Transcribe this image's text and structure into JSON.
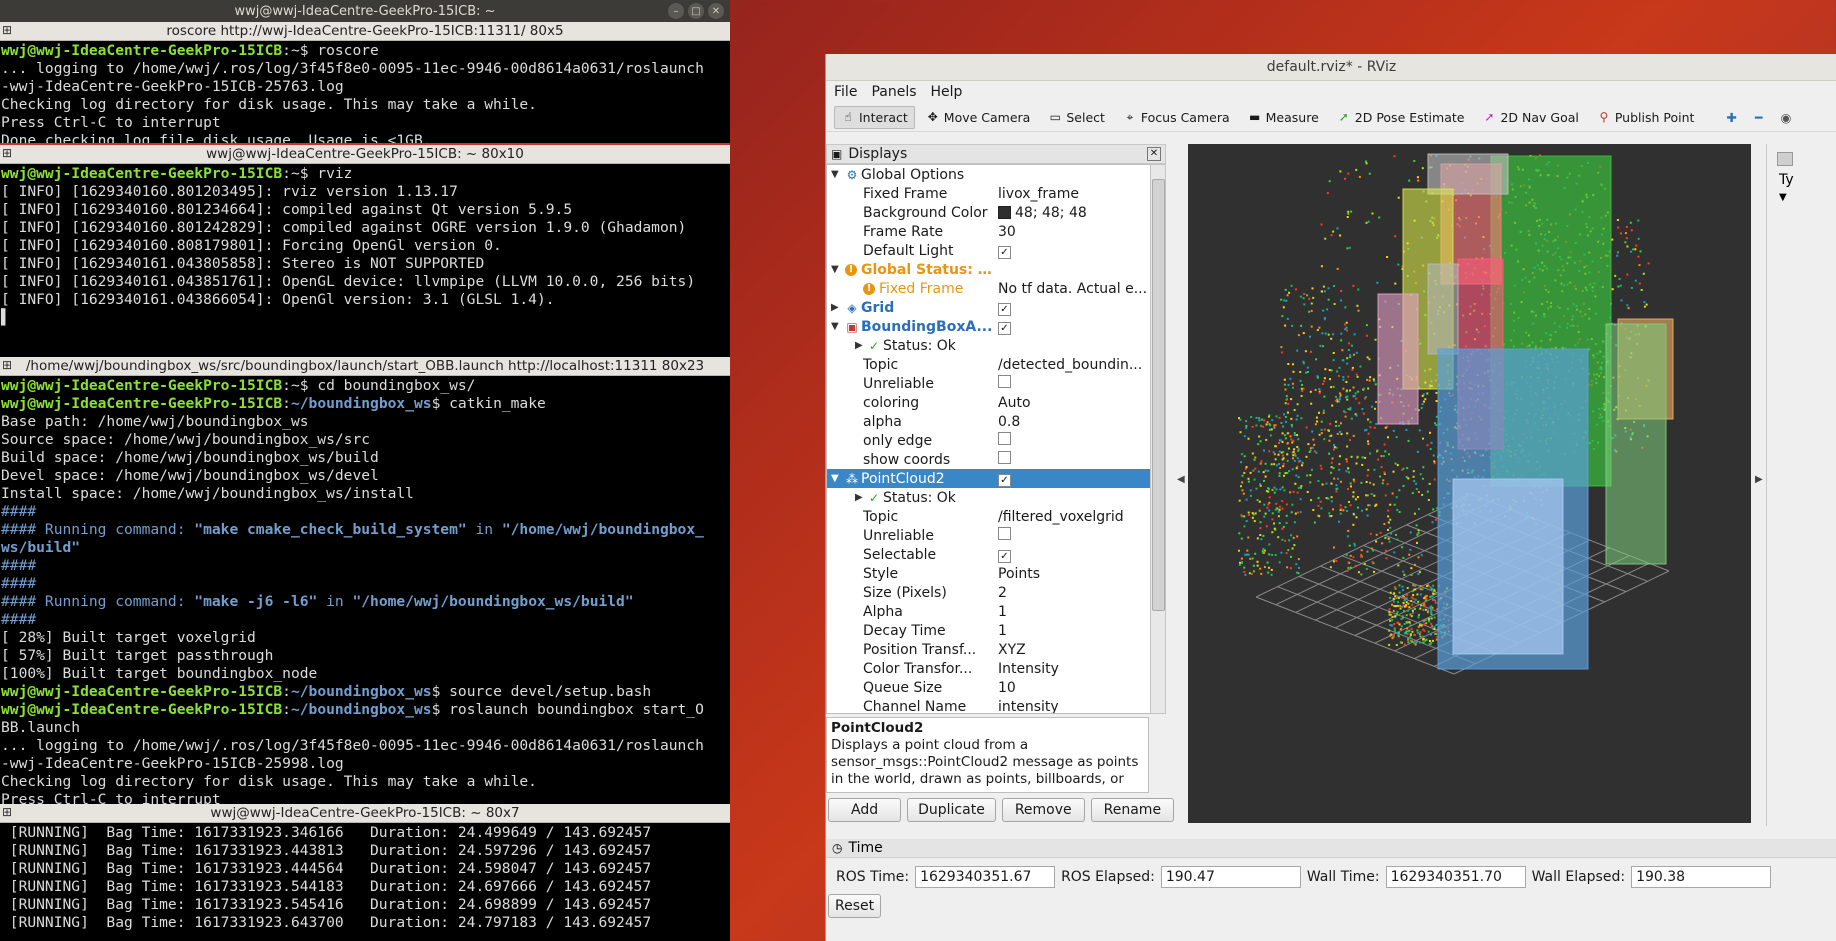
{
  "terminal": {
    "window_title": "wwj@wwj-IdeaCentre-GeekPro-15ICB: ~",
    "panes": [
      {
        "title": "roscore http://wwj-IdeaCentre-GeekPro-15ICB:11311/ 80x5",
        "lines": [
          [
            {
              "t": "wwj@wwj-IdeaCentre-GeekPro-15ICB",
              "c": "g"
            },
            {
              "t": ":~$ roscore"
            }
          ],
          [
            {
              "t": "... logging to /home/wwj/.ros/log/3f45f8e0-0095-11ec-9946-00d8614a0631/roslaunch"
            }
          ],
          [
            {
              "t": "-wwj-IdeaCentre-GeekPro-15ICB-25763.log"
            }
          ],
          [
            {
              "t": "Checking log directory for disk usage. This may take a while."
            }
          ],
          [
            {
              "t": "Press Ctrl-C to interrupt"
            }
          ],
          [
            {
              "t": "Done checking log file disk usage. Usage is <1GB."
            }
          ]
        ]
      },
      {
        "title": "wwj@wwj-IdeaCentre-GeekPro-15ICB: ~ 80x10",
        "lines": [
          [
            {
              "t": "wwj@wwj-IdeaCentre-GeekPro-15ICB",
              "c": "g"
            },
            {
              "t": ":~$ rviz"
            }
          ],
          [
            {
              "t": "[ INFO] [1629340160.801203495]: rviz version 1.13.17"
            }
          ],
          [
            {
              "t": "[ INFO] [1629340160.801234664]: compiled against Qt version 5.9.5"
            }
          ],
          [
            {
              "t": "[ INFO] [1629340160.801242829]: compiled against OGRE version 1.9.0 (Ghadamon)"
            }
          ],
          [
            {
              "t": "[ INFO] [1629340160.808179801]: Forcing OpenGl version 0."
            }
          ],
          [
            {
              "t": "[ INFO] [1629340161.043805858]: Stereo is NOT SUPPORTED"
            }
          ],
          [
            {
              "t": "[ INFO] [1629340161.043851761]: OpenGL device: llvmpipe (LLVM 10.0.0, 256 bits)"
            }
          ],
          [
            {
              "t": "[ INFO] [1629340161.043866054]: OpenGl version: 3.1 (GLSL 1.4)."
            }
          ],
          [
            {
              "t": "▌"
            }
          ]
        ]
      },
      {
        "title": "/home/wwj/boundingbox_ws/src/boundingbox/launch/start_OBB.launch http://localhost:11311 80x23",
        "lines": [
          [
            {
              "t": "wwj@wwj-IdeaCentre-GeekPro-15ICB",
              "c": "g"
            },
            {
              "t": ":~$ cd boundingbox_ws/"
            }
          ],
          [
            {
              "t": "wwj@wwj-IdeaCentre-GeekPro-15ICB",
              "c": "g"
            },
            {
              "t": ":"
            },
            {
              "t": "~/boundingbox_ws",
              "c": "b"
            },
            {
              "t": "$ catkin_make"
            }
          ],
          [
            {
              "t": "Base path: /home/wwj/boundingbox_ws"
            }
          ],
          [
            {
              "t": "Source space: /home/wwj/boundingbox_ws/src"
            }
          ],
          [
            {
              "t": "Build space: /home/wwj/boundingbox_ws/build"
            }
          ],
          [
            {
              "t": "Devel space: /home/wwj/boundingbox_ws/devel"
            }
          ],
          [
            {
              "t": "Install space: /home/wwj/boundingbox_ws/install"
            }
          ],
          [
            {
              "t": "####",
              "c": "h"
            }
          ],
          [
            {
              "t": "#### Running command: ",
              "c": "h"
            },
            {
              "t": "\"make cmake_check_build_system\"",
              "c": "hb"
            },
            {
              "t": " in ",
              "c": "h"
            },
            {
              "t": "\"/home/wwj/boundingbox_",
              "c": "hb"
            }
          ],
          [
            {
              "t": "ws/build\"",
              "c": "hb"
            }
          ],
          [
            {
              "t": "####",
              "c": "h"
            }
          ],
          [
            {
              "t": "####",
              "c": "h"
            }
          ],
          [
            {
              "t": "#### Running command: ",
              "c": "h"
            },
            {
              "t": "\"make -j6 -l6\"",
              "c": "hb"
            },
            {
              "t": " in ",
              "c": "h"
            },
            {
              "t": "\"/home/wwj/boundingbox_ws/build\"",
              "c": "hb"
            }
          ],
          [
            {
              "t": "####",
              "c": "h"
            }
          ],
          [
            {
              "t": "[ 28%] Built target voxelgrid"
            }
          ],
          [
            {
              "t": "[ 57%] Built target passthrough"
            }
          ],
          [
            {
              "t": "[100%] Built target boundingbox_node"
            }
          ],
          [
            {
              "t": "wwj@wwj-IdeaCentre-GeekPro-15ICB",
              "c": "g"
            },
            {
              "t": ":"
            },
            {
              "t": "~/boundingbox_ws",
              "c": "b"
            },
            {
              "t": "$ source devel/setup.bash"
            }
          ],
          [
            {
              "t": "wwj@wwj-IdeaCentre-GeekPro-15ICB",
              "c": "g"
            },
            {
              "t": ":"
            },
            {
              "t": "~/boundingbox_ws",
              "c": "b"
            },
            {
              "t": "$ roslaunch boundingbox start_O"
            }
          ],
          [
            {
              "t": "BB.launch"
            }
          ],
          [
            {
              "t": "... logging to /home/wwj/.ros/log/3f45f8e0-0095-11ec-9946-00d8614a0631/roslaunch"
            }
          ],
          [
            {
              "t": "-wwj-IdeaCentre-GeekPro-15ICB-25998.log"
            }
          ],
          [
            {
              "t": "Checking log directory for disk usage. This may take a while."
            }
          ],
          [
            {
              "t": "Press Ctrl-C to interrupt"
            }
          ]
        ]
      },
      {
        "title": "wwj@wwj-IdeaCentre-GeekPro-15ICB: ~ 80x7",
        "lines": [
          [
            {
              "t": " [RUNNING]  Bag Time: 1617331923.346166   Duration: 24.499649 / 143.692457"
            }
          ],
          [
            {
              "t": " [RUNNING]  Bag Time: 1617331923.443813   Duration: 24.597296 / 143.692457"
            }
          ],
          [
            {
              "t": " [RUNNING]  Bag Time: 1617331923.444564   Duration: 24.598047 / 143.692457"
            }
          ],
          [
            {
              "t": " [RUNNING]  Bag Time: 1617331923.544183   Duration: 24.697666 / 143.692457"
            }
          ],
          [
            {
              "t": " [RUNNING]  Bag Time: 1617331923.545416   Duration: 24.698899 / 143.692457"
            }
          ],
          [
            {
              "t": " [RUNNING]  Bag Time: 1617331923.643700   Duration: 24.797183 / 143.692457"
            }
          ]
        ]
      }
    ]
  },
  "rviz": {
    "title": "default.rviz* - RViz",
    "menu": [
      "File",
      "Panels",
      "Help"
    ],
    "tools": [
      {
        "label": "Interact",
        "icon": "hand-icon",
        "glyph": "☝",
        "active": true
      },
      {
        "label": "Move Camera",
        "icon": "move-camera-icon",
        "glyph": "✥"
      },
      {
        "label": "Select",
        "icon": "select-icon",
        "glyph": "▭"
      },
      {
        "label": "Focus Camera",
        "icon": "focus-camera-icon",
        "glyph": "⌖"
      },
      {
        "label": "Measure",
        "icon": "measure-icon",
        "glyph": "▬"
      },
      {
        "label": "2D Pose Estimate",
        "icon": "pose-estimate-icon",
        "glyph": "➚",
        "color": "#2ca02c"
      },
      {
        "label": "2D Nav Goal",
        "icon": "nav-goal-icon",
        "glyph": "➚",
        "color": "#c030c0"
      },
      {
        "label": "Publish Point",
        "icon": "publish-point-icon",
        "glyph": "⚲",
        "color": "#c0392b"
      }
    ],
    "displays_title": "Displays",
    "tree": [
      {
        "indent": 0,
        "arrow": "▼",
        "icon": "gear-icon",
        "glyph": "⚙",
        "key": "Global Options"
      },
      {
        "indent": 1,
        "key": "Fixed Frame",
        "value": "livox_frame"
      },
      {
        "indent": 1,
        "key": "Background Color",
        "value": "48; 48; 48",
        "swatch": true
      },
      {
        "indent": 1,
        "key": "Frame Rate",
        "value": "30"
      },
      {
        "indent": 1,
        "key": "Default Light",
        "check": true
      },
      {
        "indent": 0,
        "arrow": "▼",
        "icon": "warning-icon",
        "glyph": "!",
        "key": "Global Status: ...",
        "style": "orangeb"
      },
      {
        "indent": 1,
        "icon": "warning-icon",
        "glyph": "!",
        "key": "Fixed Frame",
        "value": "No tf data.  Actual e...",
        "style": "orange"
      },
      {
        "indent": 0,
        "arrow": "▶",
        "icon": "grid-icon",
        "glyph": "◈",
        "key": "Grid",
        "style": "blue",
        "check": true
      },
      {
        "indent": 0,
        "arrow": "▼",
        "icon": "boundingbox-icon",
        "glyph": "▣",
        "key": "BoundingBoxA...",
        "style": "blue",
        "check": true
      },
      {
        "indent": 1,
        "arrow": "▶",
        "icon": "check-icon",
        "glyph": "✓",
        "key": "Status: Ok"
      },
      {
        "indent": 1,
        "key": "Topic",
        "value": "/detected_boundin..."
      },
      {
        "indent": 1,
        "key": "Unreliable",
        "check": false
      },
      {
        "indent": 1,
        "key": "coloring",
        "value": "Auto"
      },
      {
        "indent": 1,
        "key": "alpha",
        "value": "0.8"
      },
      {
        "indent": 1,
        "key": "only edge",
        "check": false
      },
      {
        "indent": 1,
        "key": "show coords",
        "check": false
      },
      {
        "indent": 0,
        "arrow": "▼",
        "icon": "pointcloud-icon",
        "glyph": "⁂",
        "key": "PointCloud2",
        "check": true,
        "selected": true
      },
      {
        "indent": 1,
        "arrow": "▶",
        "icon": "check-icon",
        "glyph": "✓",
        "key": "Status: Ok"
      },
      {
        "indent": 1,
        "key": "Topic",
        "value": "/filtered_voxelgrid"
      },
      {
        "indent": 1,
        "key": "Unreliable",
        "check": false
      },
      {
        "indent": 1,
        "key": "Selectable",
        "check": true
      },
      {
        "indent": 1,
        "key": "Style",
        "value": "Points"
      },
      {
        "indent": 1,
        "key": "Size (Pixels)",
        "value": "2"
      },
      {
        "indent": 1,
        "key": "Alpha",
        "value": "1"
      },
      {
        "indent": 1,
        "key": "Decay Time",
        "value": "1"
      },
      {
        "indent": 1,
        "key": "Position Transf...",
        "value": "XYZ"
      },
      {
        "indent": 1,
        "key": "Color Transfor...",
        "value": "Intensity"
      },
      {
        "indent": 1,
        "key": "Queue Size",
        "value": "10"
      },
      {
        "indent": 1,
        "key": "Channel Name",
        "value": "intensity"
      }
    ],
    "description": {
      "title": "PointCloud2",
      "text": "Displays a point cloud from a sensor_msgs::PointCloud2 message as points in the world, drawn as points, billboards, or"
    },
    "buttons": [
      "Add",
      "Duplicate",
      "Remove",
      "Rename"
    ],
    "right_panel_label": "Ty",
    "time": {
      "title": "Time",
      "ros_time_label": "ROS Time:",
      "ros_time": "1629340351.67",
      "ros_elapsed_label": "ROS Elapsed:",
      "ros_elapsed": "190.47",
      "wall_time_label": "Wall Time:",
      "wall_time": "1629340351.70",
      "wall_elapsed_label": "Wall Elapsed:",
      "wall_elapsed": "190.38",
      "reset_label": "Reset"
    },
    "background_color": "#303030"
  }
}
